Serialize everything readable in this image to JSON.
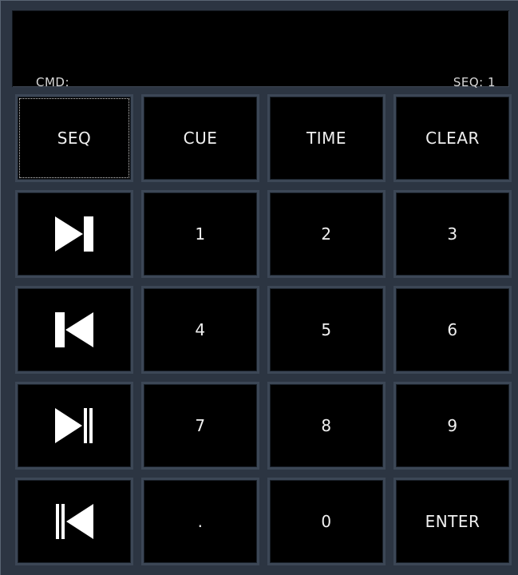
{
  "display": {
    "cmd_label": "CMD:",
    "seq_status": "SEQ: 1"
  },
  "keys": {
    "seq": "SEQ",
    "cue": "CUE",
    "time": "TIME",
    "clear": "CLEAR",
    "d1": "1",
    "d2": "2",
    "d3": "3",
    "d4": "4",
    "d5": "5",
    "d6": "6",
    "d7": "7",
    "d8": "8",
    "d9": "9",
    "dot": ".",
    "d0": "0",
    "enter": "ENTER"
  },
  "icons": {
    "next_cue": "skip-next-icon",
    "previous_cue": "skip-previous-icon",
    "go": "play-pause-next-icon",
    "back": "pause-previous-icon"
  },
  "colors": {
    "background": "#2c3542",
    "key_fill": "#000000",
    "key_border": "#3c4756",
    "text": "#f0f0f0"
  }
}
